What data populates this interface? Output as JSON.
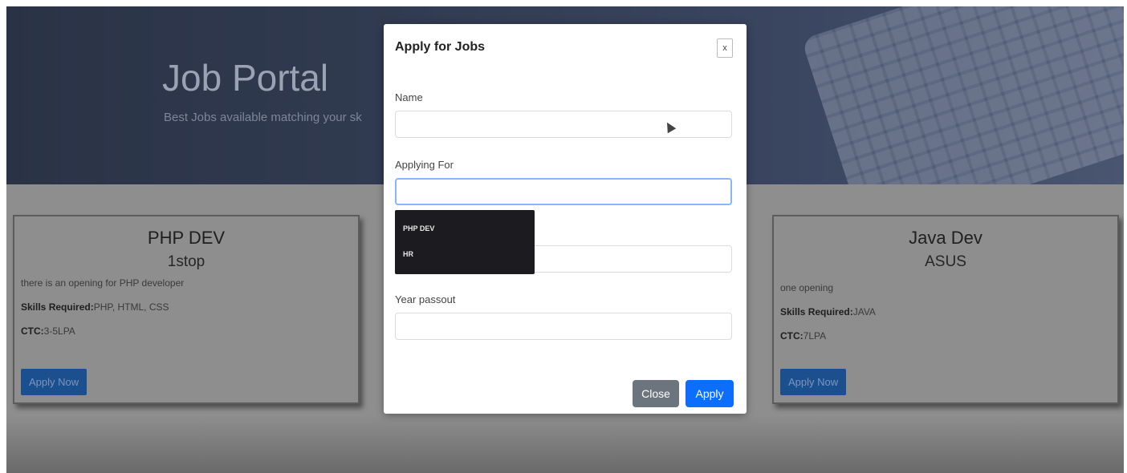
{
  "hero": {
    "title": "Job Portal",
    "subtitle": "Best Jobs available matching your sk"
  },
  "cards": [
    {
      "title": "PHP DEV",
      "company": "1stop",
      "description": "there is an opening for PHP developer",
      "skills_label": "Skills Required:",
      "skills": "PHP, HTML, CSS",
      "ctc_label": "CTC:",
      "ctc": "3-5LPA",
      "button": "Apply Now"
    },
    {
      "title": "Java Dev",
      "company": "ASUS",
      "description": "one opening",
      "skills_label": "Skills Required:",
      "skills": "JAVA",
      "ctc_label": "CTC:",
      "ctc": "7LPA",
      "button": "Apply Now"
    }
  ],
  "modal": {
    "title": "Apply for Jobs",
    "close_icon": "x",
    "fields": [
      {
        "label": "Name",
        "value": ""
      },
      {
        "label": "Applying For",
        "value": ""
      },
      {
        "label": "",
        "value": ""
      },
      {
        "label": "Year passout",
        "value": ""
      }
    ],
    "dropdown_options": [
      "PHP DEV",
      "HR"
    ],
    "close_button": "Close",
    "apply_button": "Apply"
  },
  "colors": {
    "primary": "#0d6efd",
    "secondary": "#6c757d",
    "hero_bg": "#2a3346",
    "overlay": "#8e8e8e"
  }
}
